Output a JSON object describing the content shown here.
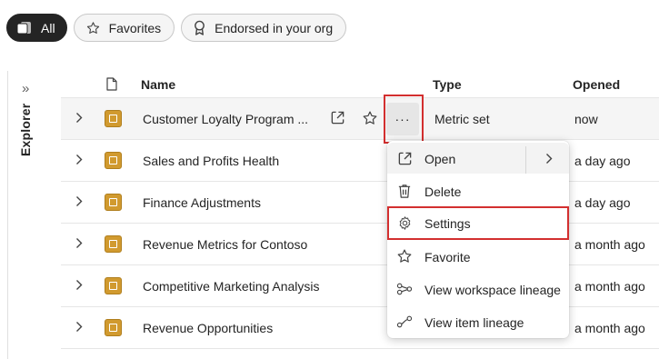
{
  "filters": [
    {
      "label": "All",
      "icon": "stack-icon",
      "active": true
    },
    {
      "label": "Favorites",
      "icon": "star-icon",
      "active": false
    },
    {
      "label": "Endorsed in your org",
      "icon": "ribbon-icon",
      "active": false
    }
  ],
  "explorer": {
    "label": "Explorer",
    "toggle_icon": "double-chevron-right-icon"
  },
  "table": {
    "headers": {
      "icon": "document-icon",
      "name": "Name",
      "type": "Type",
      "opened": "Opened"
    },
    "rows": [
      {
        "name": "Customer Loyalty Program ...",
        "type": "Metric set",
        "opened": "now"
      },
      {
        "name": "Sales and Profits Health",
        "type": "",
        "opened": "a day ago"
      },
      {
        "name": "Finance Adjustments",
        "type": "",
        "opened": "a day ago"
      },
      {
        "name": "Revenue Metrics for Contoso",
        "type": "",
        "opened": "a month ago"
      },
      {
        "name": "Competitive Marketing Analysis",
        "type": "",
        "opened": "a month ago"
      },
      {
        "name": "Revenue Opportunities",
        "type": "",
        "opened": "a month ago"
      }
    ],
    "row_actions": {
      "open_icon": "open-external-icon",
      "favorite_icon": "star-icon",
      "more_label": "···"
    }
  },
  "context_menu": {
    "items": [
      {
        "label": "Open",
        "icon": "open-external-icon",
        "has_submenu": true
      },
      {
        "label": "Delete",
        "icon": "trash-icon"
      },
      {
        "label": "Settings",
        "icon": "gear-icon",
        "highlighted": true
      },
      {
        "label": "Favorite",
        "icon": "star-icon"
      },
      {
        "label": "View workspace lineage",
        "icon": "lineage-graph-icon"
      },
      {
        "label": "View item lineage",
        "icon": "item-lineage-icon"
      }
    ]
  },
  "colors": {
    "highlight": "#d32f2f",
    "item_icon": "#d19a2f",
    "active_pill": "#242424"
  }
}
